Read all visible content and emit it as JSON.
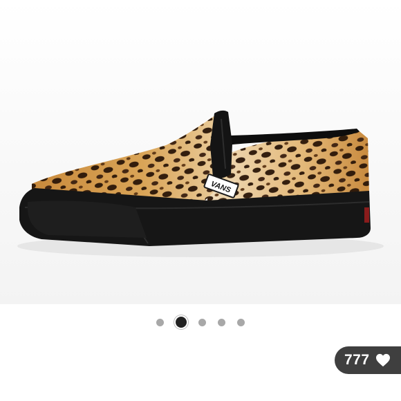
{
  "product_image": {
    "alt": "",
    "brand_mark": "VANS",
    "colors": {
      "print_dark": "#2a1608",
      "print_base": "#c98a3c",
      "sole": "#161616"
    }
  },
  "carousel": {
    "total": 5,
    "active_index": 1
  },
  "likes": {
    "count": "777",
    "icon": "heart-icon"
  }
}
